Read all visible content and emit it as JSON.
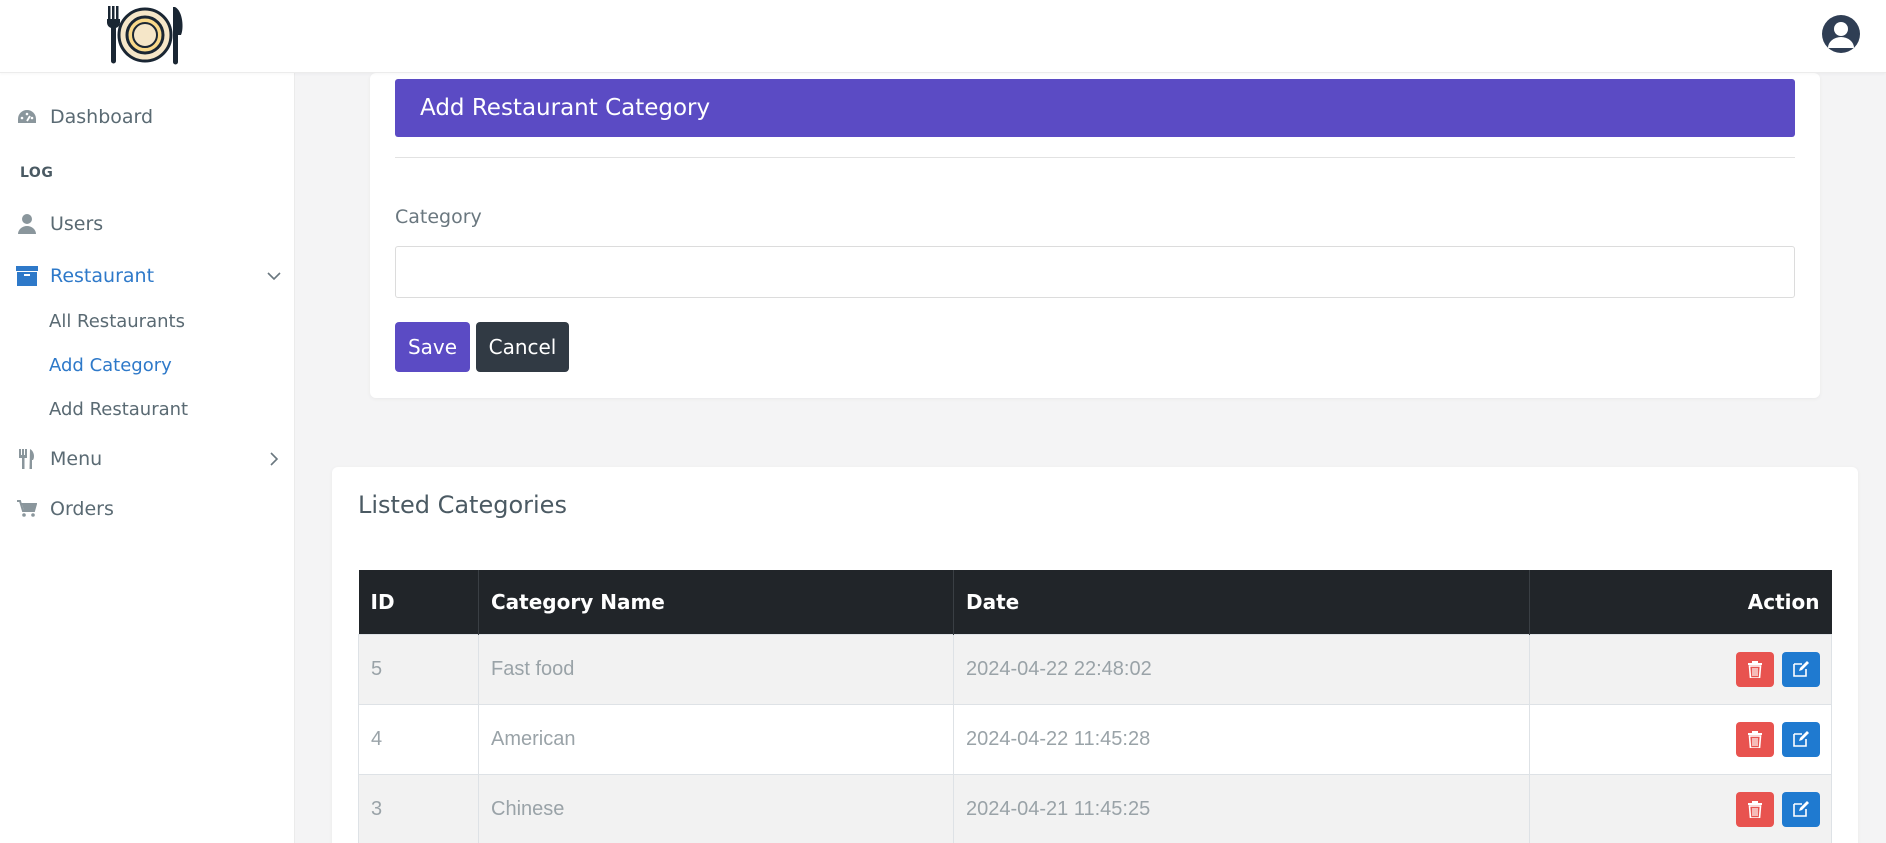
{
  "header": {
    "logo_name": "plate-fork-knife-logo",
    "avatar_icon": "user-avatar-icon"
  },
  "sidebar": {
    "items": [
      {
        "label": "Dashboard",
        "icon": "dashboard-icon"
      },
      {
        "label": "Users",
        "icon": "user-icon"
      },
      {
        "label": "Restaurant",
        "icon": "archive-icon",
        "expanded": true
      },
      {
        "label": "Menu",
        "icon": "cutlery-icon"
      },
      {
        "label": "Orders",
        "icon": "cart-icon"
      }
    ],
    "section_label": "LOG",
    "restaurant_sub": [
      "All Restaurants",
      "Add Category",
      "Add Restaurant"
    ]
  },
  "form": {
    "title": "Add Restaurant Category",
    "field_label": "Category",
    "field_value": "",
    "save_label": "Save",
    "cancel_label": "Cancel"
  },
  "table": {
    "title": "Listed Categories",
    "columns": [
      "ID",
      "Category Name",
      "Date",
      "Action"
    ],
    "rows": [
      {
        "id": "5",
        "name": "Fast food",
        "date": "2024-04-22 22:48:02"
      },
      {
        "id": "4",
        "name": "American",
        "date": "2024-04-22 11:45:28"
      },
      {
        "id": "3",
        "name": "Chinese",
        "date": "2024-04-21 11:45:25"
      }
    ],
    "action_icons": [
      "trash-icon",
      "edit-icon"
    ]
  },
  "colors": {
    "primary": "#5b4bc4",
    "dark": "#313a44",
    "danger": "#e8534f",
    "info": "#1f7ad0",
    "link_active": "#2e79c9"
  }
}
